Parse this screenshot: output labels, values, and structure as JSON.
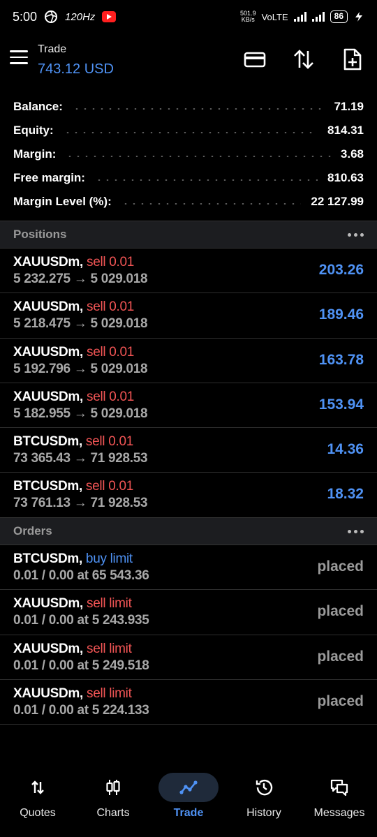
{
  "status_bar": {
    "time": "5:00",
    "refresh_rate": "120Hz",
    "net_speed": "501.9\nKB/s",
    "network": "VoLTE",
    "battery": "86"
  },
  "appbar": {
    "title": "Trade",
    "balance": "743.12 USD"
  },
  "summary": [
    {
      "label": "Balance:",
      "value": "71.19"
    },
    {
      "label": "Equity:",
      "value": "814.31"
    },
    {
      "label": "Margin:",
      "value": "3.68"
    },
    {
      "label": "Free margin:",
      "value": "810.63"
    },
    {
      "label": "Margin Level (%):",
      "value": "22 127.99"
    }
  ],
  "positions": {
    "title": "Positions",
    "items": [
      {
        "symbol": "XAUUSDm,",
        "action": "sell 0.01",
        "prices": "5 232.275 → 5 029.018",
        "profit": "203.26"
      },
      {
        "symbol": "XAUUSDm,",
        "action": "sell 0.01",
        "prices": "5 218.475 → 5 029.018",
        "profit": "189.46"
      },
      {
        "symbol": "XAUUSDm,",
        "action": "sell 0.01",
        "prices": "5 192.796 → 5 029.018",
        "profit": "163.78"
      },
      {
        "symbol": "XAUUSDm,",
        "action": "sell 0.01",
        "prices": "5 182.955 → 5 029.018",
        "profit": "153.94"
      },
      {
        "symbol": "BTCUSDm,",
        "action": "sell 0.01",
        "prices": "73 365.43 → 71 928.53",
        "profit": "14.36"
      },
      {
        "symbol": "BTCUSDm,",
        "action": "sell 0.01",
        "prices": "73 761.13 → 71 928.53",
        "profit": "18.32"
      }
    ]
  },
  "orders": {
    "title": "Orders",
    "items": [
      {
        "symbol": "BTCUSDm,",
        "action": "buy limit",
        "detail": "0.01 / 0.00 at 65 543.36",
        "status": "placed"
      },
      {
        "symbol": "XAUUSDm,",
        "action": "sell limit",
        "detail": "0.01 / 0.00 at 5 243.935",
        "status": "placed"
      },
      {
        "symbol": "XAUUSDm,",
        "action": "sell limit",
        "detail": "0.01 / 0.00 at 5 249.518",
        "status": "placed"
      },
      {
        "symbol": "XAUUSDm,",
        "action": "sell limit",
        "detail": "0.01 / 0.00 at 5 224.133",
        "status": "placed"
      }
    ]
  },
  "bottom_nav": [
    {
      "label": "Quotes",
      "icon": "quotes-arrows-icon"
    },
    {
      "label": "Charts",
      "icon": "candlestick-icon"
    },
    {
      "label": "Trade",
      "icon": "trend-line-icon",
      "active": true
    },
    {
      "label": "History",
      "icon": "history-clock-icon"
    },
    {
      "label": "Messages",
      "icon": "chat-bubbles-icon"
    }
  ],
  "colors": {
    "accent": "#4f92f4",
    "sell": "#f25555",
    "muted": "#9a9a9a",
    "section_bg": "#1c1d20"
  }
}
